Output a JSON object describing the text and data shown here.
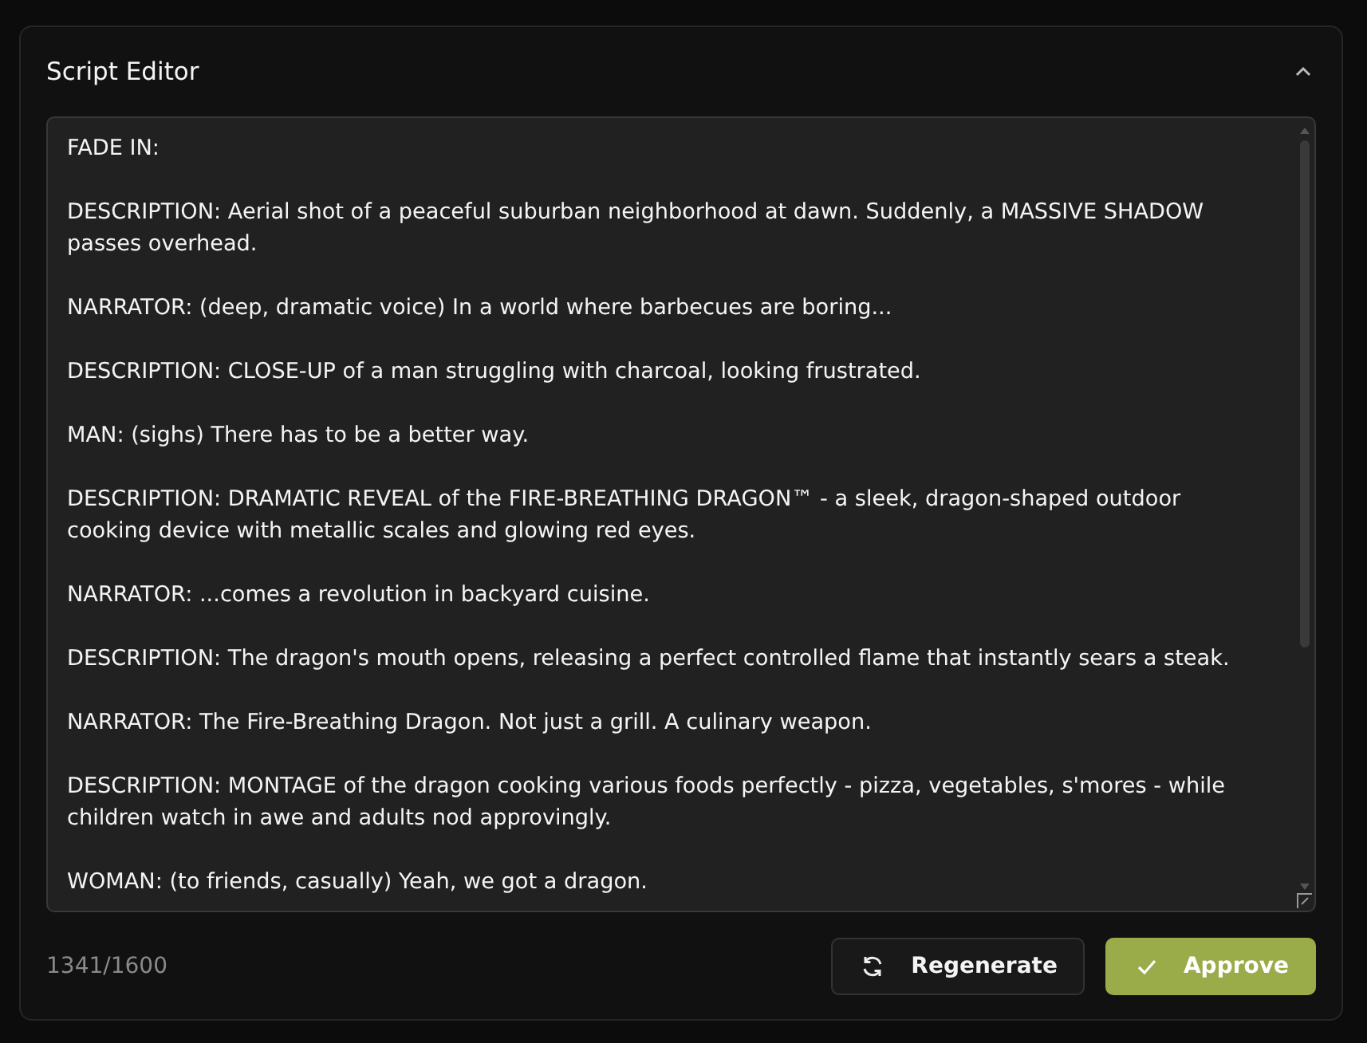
{
  "panel": {
    "title": "Script Editor",
    "expanded": true
  },
  "script": [
    "FADE IN:",
    "DESCRIPTION: Aerial shot of a peaceful suburban neighborhood at dawn. Suddenly, a MASSIVE SHADOW passes overhead.",
    "NARRATOR: (deep, dramatic voice) In a world where barbecues are boring...",
    "DESCRIPTION: CLOSE-UP of a man struggling with charcoal, looking frustrated.",
    "MAN: (sighs) There has to be a better way.",
    "DESCRIPTION: DRAMATIC REVEAL of the FIRE-BREATHING DRAGON™ - a sleek, dragon-shaped outdoor cooking device with metallic scales and glowing red eyes.",
    "NARRATOR: ...comes a revolution in backyard cuisine.",
    "DESCRIPTION: The dragon's mouth opens, releasing a perfect controlled flame that instantly sears a steak.",
    "NARRATOR: The Fire-Breathing Dragon. Not just a grill. A culinary weapon.",
    "DESCRIPTION: MONTAGE of the dragon cooking various foods perfectly - pizza, vegetables, s'mores - while children watch in awe and adults nod approvingly.",
    "WOMAN: (to friends, casually) Yeah, we got a dragon."
  ],
  "counter": "1341/1600",
  "buttons": [
    {
      "label": "Regenerate",
      "kind": "secondary"
    },
    {
      "label": "Approve",
      "kind": "primary"
    }
  ]
}
